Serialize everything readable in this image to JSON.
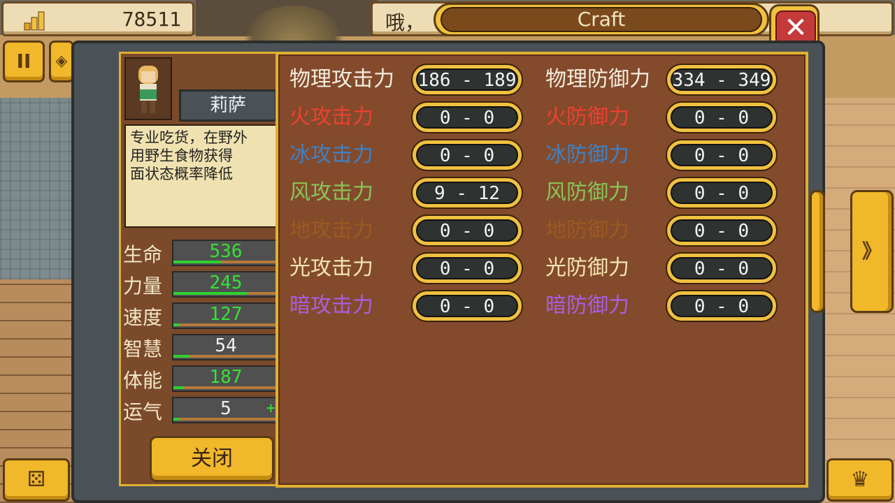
{
  "hud": {
    "gold": "78511",
    "message": "哦，",
    "panel_title": "Craft",
    "close_symbol": "✕"
  },
  "character": {
    "name": "莉萨",
    "description": "专业吃货，在野外\n用野生食物获得\n面状态概率降低"
  },
  "stats": [
    {
      "label": "生命",
      "value": "536",
      "color": "#38e038",
      "fill": 0.45
    },
    {
      "label": "力量",
      "value": "245",
      "color": "#38e038",
      "fill": 0.7
    },
    {
      "label": "速度",
      "value": "127",
      "color": "#38e038",
      "fill": 0.05
    },
    {
      "label": "智慧",
      "value": "54",
      "color": "#f0f0f0",
      "fill": 0.15
    },
    {
      "label": "体能",
      "value": "187",
      "color": "#38e038",
      "fill": 0.1
    },
    {
      "label": "运气",
      "value": "5",
      "color": "#f0f0f0",
      "fill": 0.05,
      "plus": "+"
    }
  ],
  "buttons": {
    "close": "关闭"
  },
  "attributes": {
    "attack": [
      {
        "label": "物理攻击力",
        "value": "186 - 189",
        "color": "#f3eede"
      },
      {
        "label": "火攻击力",
        "value": "0 - 0",
        "color": "#ee4030"
      },
      {
        "label": "冰攻击力",
        "value": "0 - 0",
        "color": "#3c82c8"
      },
      {
        "label": "风攻击力",
        "value": "9 - 12",
        "color": "#88c458"
      },
      {
        "label": "地攻击力",
        "value": "0 - 0",
        "color": "#9a5a1e"
      },
      {
        "label": "光攻击力",
        "value": "0 - 0",
        "color": "#f2e6b0"
      },
      {
        "label": "暗攻击力",
        "value": "0 - 0",
        "color": "#a860e0"
      }
    ],
    "defense": [
      {
        "label": "物理防御力",
        "value": "334 - 349",
        "color": "#f3eede"
      },
      {
        "label": "火防御力",
        "value": "0 - 0",
        "color": "#ee4030"
      },
      {
        "label": "冰防御力",
        "value": "0 - 0",
        "color": "#3c82c8"
      },
      {
        "label": "风防御力",
        "value": "0 - 0",
        "color": "#88c458"
      },
      {
        "label": "地防御力",
        "value": "0 - 0",
        "color": "#9a5a1e"
      },
      {
        "label": "光防御力",
        "value": "0 - 0",
        "color": "#f2e6b0"
      },
      {
        "label": "暗防御力",
        "value": "0 - 0",
        "color": "#a860e0"
      }
    ]
  },
  "nav": {
    "prev_symbol": "《",
    "next_symbol": "》",
    "pause_symbol": "II"
  }
}
